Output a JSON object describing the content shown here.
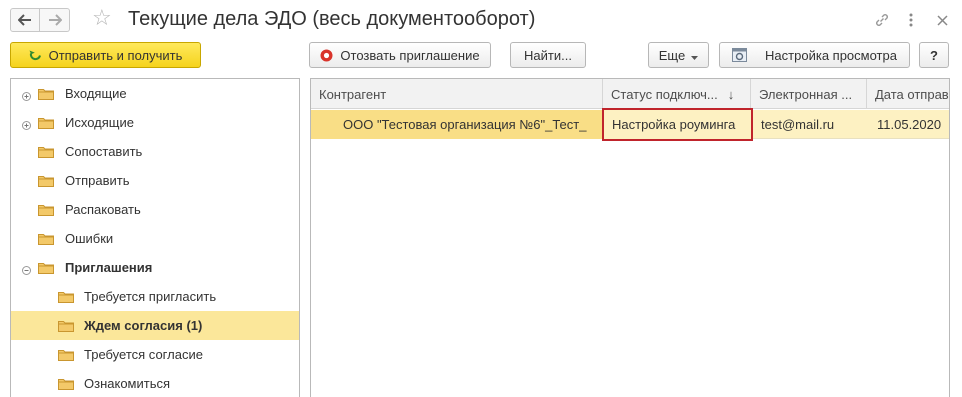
{
  "window": {
    "title": "Текущие дела ЭДО (весь документооборот)",
    "icons": [
      "back-arrow-icon",
      "forward-arrow-icon",
      "star-icon",
      "link-icon",
      "more-vertical-icon",
      "close-icon"
    ]
  },
  "toolbar": {
    "send_receive_label": "Отправить и получить",
    "revoke_invitation_label": "Отозвать приглашение",
    "find_label": "Найти...",
    "more_label": "Еще",
    "view_settings_label": "Настройка просмотра",
    "help_label": "?"
  },
  "tree": {
    "items": [
      {
        "label": "Входящие",
        "expander": "plus",
        "bold": false,
        "selected": false,
        "level": 0
      },
      {
        "label": "Исходящие",
        "expander": "plus",
        "bold": false,
        "selected": false,
        "level": 0
      },
      {
        "label": "Сопоставить",
        "expander": "",
        "bold": false,
        "selected": false,
        "level": 0
      },
      {
        "label": "Отправить",
        "expander": "",
        "bold": false,
        "selected": false,
        "level": 0
      },
      {
        "label": "Распаковать",
        "expander": "",
        "bold": false,
        "selected": false,
        "level": 0
      },
      {
        "label": "Ошибки",
        "expander": "",
        "bold": false,
        "selected": false,
        "level": 0
      },
      {
        "label": "Приглашения",
        "expander": "minus",
        "bold": true,
        "selected": false,
        "level": 0
      },
      {
        "label": "Требуется пригласить",
        "expander": "",
        "bold": false,
        "selected": false,
        "level": 1
      },
      {
        "label": "Ждем согласия (1)",
        "expander": "",
        "bold": true,
        "selected": true,
        "level": 1
      },
      {
        "label": "Требуется согласие",
        "expander": "",
        "bold": false,
        "selected": false,
        "level": 1
      },
      {
        "label": "Ознакомиться",
        "expander": "",
        "bold": false,
        "selected": false,
        "level": 1
      }
    ]
  },
  "grid": {
    "columns": [
      {
        "label": "Контрагент"
      },
      {
        "label": "Статус подключ...",
        "sort": "↓"
      },
      {
        "label": "Электронная ..."
      },
      {
        "label": "Дата отправ"
      }
    ],
    "rows": [
      {
        "counterparty": "ООО \"Тестовая организация №6\"_Тест_",
        "status": "Настройка роуминга",
        "email": "test@mail.ru",
        "date": "11.05.2020"
      }
    ]
  },
  "colors": {
    "primary_button": "#f5d31d",
    "selected_row": "#fbe79a",
    "highlight_border": "#c0242c",
    "folder": "#e8b84a"
  }
}
